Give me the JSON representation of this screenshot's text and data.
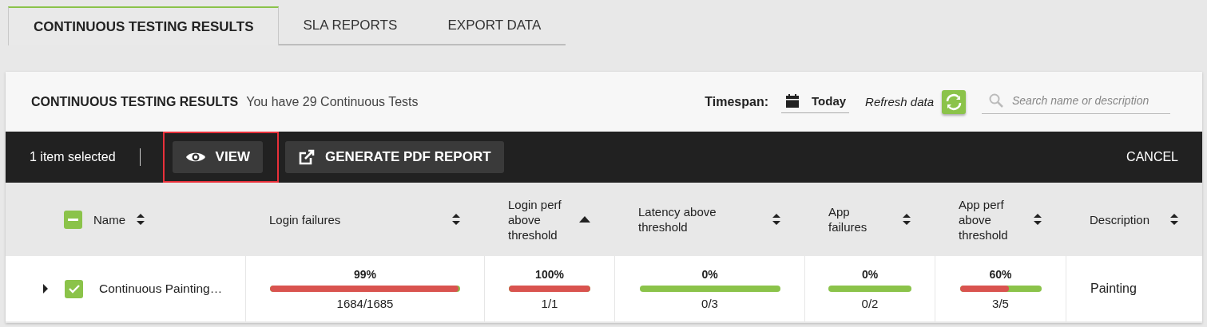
{
  "tabs": [
    {
      "label": "CONTINUOUS TESTING RESULTS",
      "selected": true
    },
    {
      "label": "SLA REPORTS",
      "selected": false
    },
    {
      "label": "EXPORT DATA",
      "selected": false
    }
  ],
  "header": {
    "title": "CONTINUOUS TESTING RESULTS",
    "subtitle": "You have 29 Continuous Tests",
    "timespan_label": "Timespan:",
    "timespan_value": "Today",
    "refresh_label": "Refresh data",
    "search": {
      "placeholder": "Search name or description"
    }
  },
  "selection_bar": {
    "count_text": "1 item selected",
    "buttons": [
      {
        "label": "VIEW",
        "kind": "view",
        "highlighted": true
      },
      {
        "label": "GENERATE PDF REPORT",
        "kind": "export",
        "highlighted": false
      }
    ],
    "cancel": "CANCEL"
  },
  "table": {
    "select_all_partial": true,
    "columns": [
      {
        "label": "Name",
        "sorted": false
      },
      {
        "label": "Login failures",
        "sorted": false
      },
      {
        "label": "Login perf above threshold",
        "sorted": true
      },
      {
        "label": "Latency above threshold",
        "sorted": false
      },
      {
        "label": "App failures",
        "sorted": false
      },
      {
        "label": "App perf above threshold",
        "sorted": false
      },
      {
        "label": "Description",
        "sorted": false
      }
    ],
    "rows": [
      {
        "expanded": false,
        "checked": true,
        "name": "Continuous Painting…",
        "description": "Painting",
        "metrics": [
          {
            "percent": "99%",
            "level": 0.99,
            "fraction": "1684/1685"
          },
          {
            "percent": "100%",
            "level": 1,
            "fraction": "1/1"
          },
          {
            "percent": "0%",
            "level": 0,
            "fraction": "0/3"
          },
          {
            "percent": "0%",
            "level": 0,
            "fraction": "0/2"
          },
          {
            "percent": "60%",
            "level": 0.6,
            "fraction": "3/5"
          }
        ]
      }
    ]
  }
}
